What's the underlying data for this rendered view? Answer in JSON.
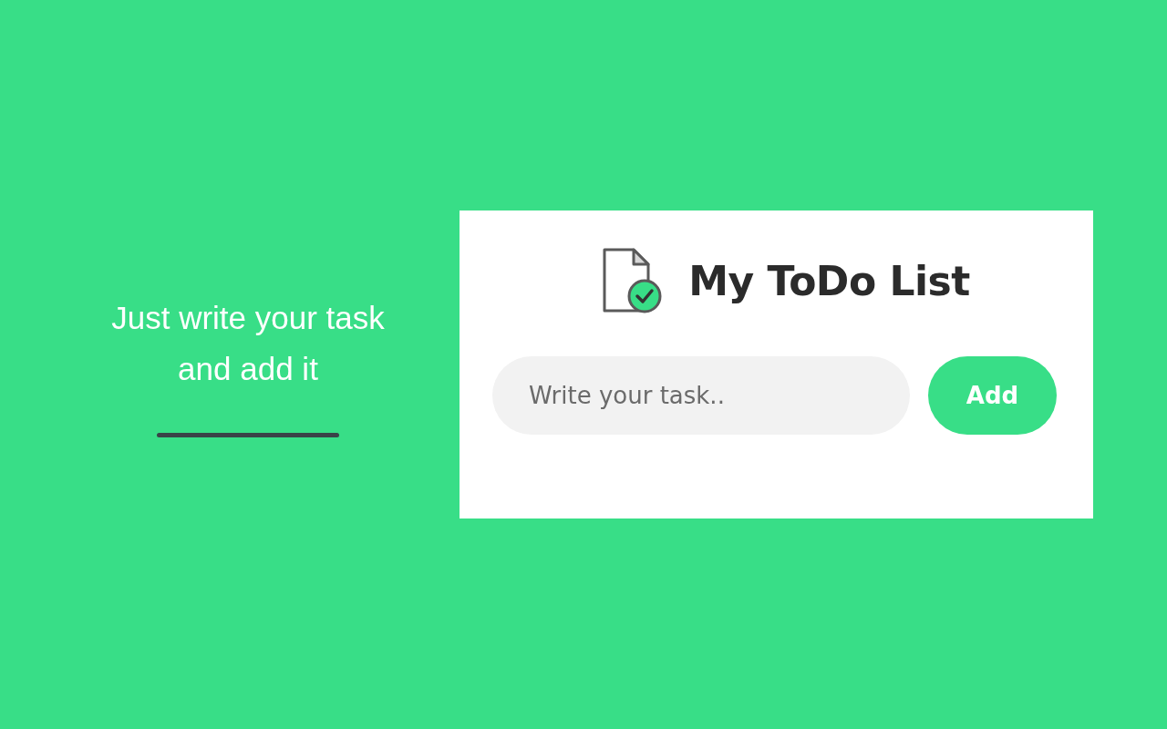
{
  "promo": {
    "lines": [
      "Just write your task",
      "and add it"
    ]
  },
  "app": {
    "title": "My ToDo List",
    "input": {
      "placeholder": "Write your task.."
    },
    "button": "Add"
  }
}
